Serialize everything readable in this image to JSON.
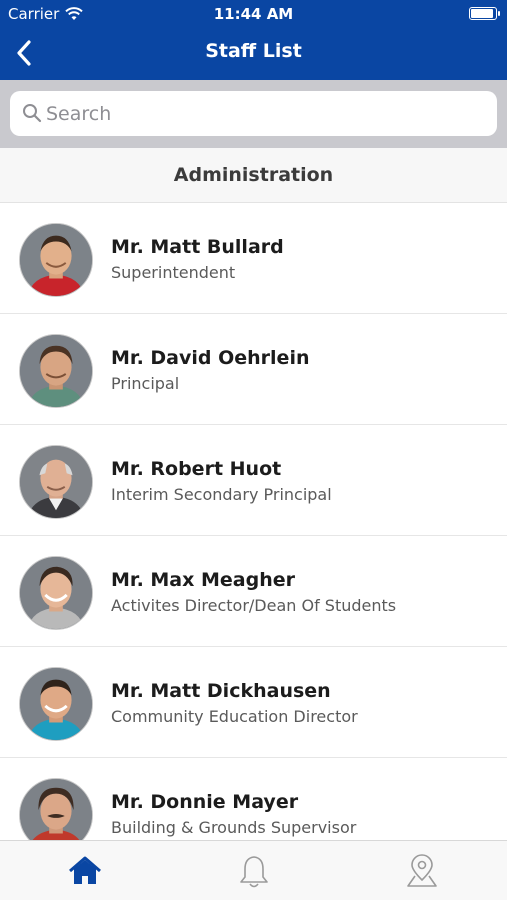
{
  "status_bar": {
    "carrier": "Carrier",
    "time": "11:44 AM"
  },
  "nav": {
    "title": "Staff List"
  },
  "search": {
    "placeholder": "Search"
  },
  "section": {
    "title": "Administration"
  },
  "staff": [
    {
      "name": "Mr. Matt Bullard",
      "role": "Superintendent"
    },
    {
      "name": "Mr. David Oehrlein",
      "role": "Principal"
    },
    {
      "name": "Mr. Robert Huot",
      "role": "Interim Secondary Principal"
    },
    {
      "name": "Mr. Max Meagher",
      "role": "Activites Director/Dean Of Students"
    },
    {
      "name": "Mr. Matt Dickhausen",
      "role": "Community Education Director"
    },
    {
      "name": "Mr. Donnie Mayer",
      "role": "Building & Grounds Supervisor"
    }
  ],
  "tabbar": {
    "items": [
      "home-icon",
      "bell-icon",
      "map-pin-icon"
    ],
    "active": "home-icon"
  },
  "colors": {
    "brand": "#0a46a3",
    "active_tab": "#0a46a3",
    "inactive_tab": "#9a9a9a"
  }
}
